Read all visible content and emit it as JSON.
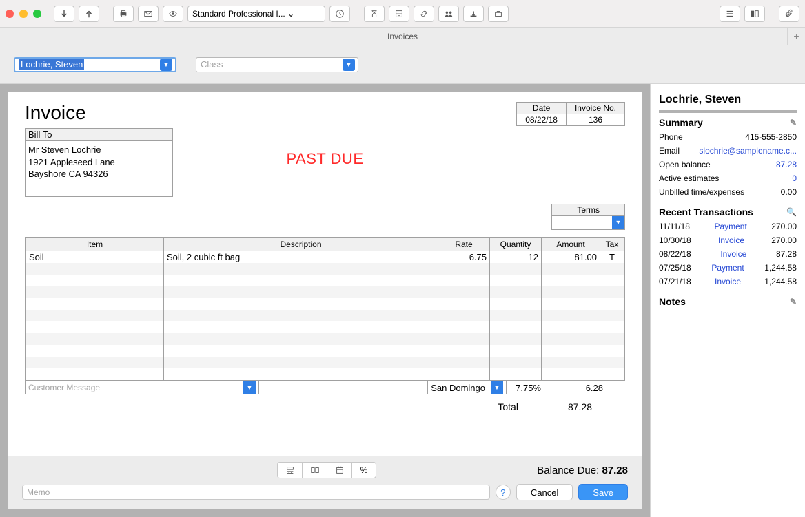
{
  "window": {
    "title": "Invoices",
    "template_dropdown": "Standard Professional I...   ⌄",
    "tab_label": "Invoices"
  },
  "selectors": {
    "customer": "Lochrie, Steven",
    "class_placeholder": "Class"
  },
  "invoice": {
    "heading": "Invoice",
    "date_label": "Date",
    "date_value": "08/22/18",
    "invno_label": "Invoice No.",
    "invno_value": "136",
    "billto_label": "Bill To",
    "billto_line1": "Mr Steven Lochrie",
    "billto_line2": "1921 Appleseed Lane",
    "billto_line3": "Bayshore CA 94326",
    "stamp": "PAST DUE",
    "terms_label": "Terms",
    "columns": {
      "item": "Item",
      "description": "Description",
      "rate": "Rate",
      "quantity": "Quantity",
      "amount": "Amount",
      "tax": "Tax"
    },
    "line": {
      "item": "Soil",
      "description": "Soil, 2 cubic ft bag",
      "rate": "6.75",
      "quantity": "12",
      "amount": "81.00",
      "tax": "T"
    },
    "customer_message_placeholder": "Customer Message",
    "tax_region": "San Domingo",
    "tax_rate": "7.75%",
    "tax_amount": "6.28",
    "total_label": "Total",
    "total_value": "87.28"
  },
  "bottom": {
    "balance_due_label": "Balance Due:",
    "balance_due_value": "87.28",
    "memo_placeholder": "Memo",
    "cancel_label": "Cancel",
    "save_label": "Save"
  },
  "sidebar": {
    "customer_name": "Lochrie, Steven",
    "summary_heading": "Summary",
    "phone_label": "Phone",
    "phone": "415-555-2850",
    "email_label": "Email",
    "email": "slochrie@samplename.c...",
    "openbal_label": "Open balance",
    "openbal": "87.28",
    "estimates_label": "Active estimates",
    "estimates": "0",
    "unbilled_label": "Unbilled time/expenses",
    "unbilled": "0.00",
    "recent_heading": "Recent Transactions",
    "transactions": [
      {
        "date": "11/11/18",
        "type": "Payment",
        "amount": "270.00"
      },
      {
        "date": "10/30/18",
        "type": "Invoice",
        "amount": "270.00"
      },
      {
        "date": "08/22/18",
        "type": "Invoice",
        "amount": "87.28"
      },
      {
        "date": "07/25/18",
        "type": "Payment",
        "amount": "1,244.58"
      },
      {
        "date": "07/21/18",
        "type": "Invoice",
        "amount": "1,244.58"
      }
    ],
    "notes_heading": "Notes"
  }
}
